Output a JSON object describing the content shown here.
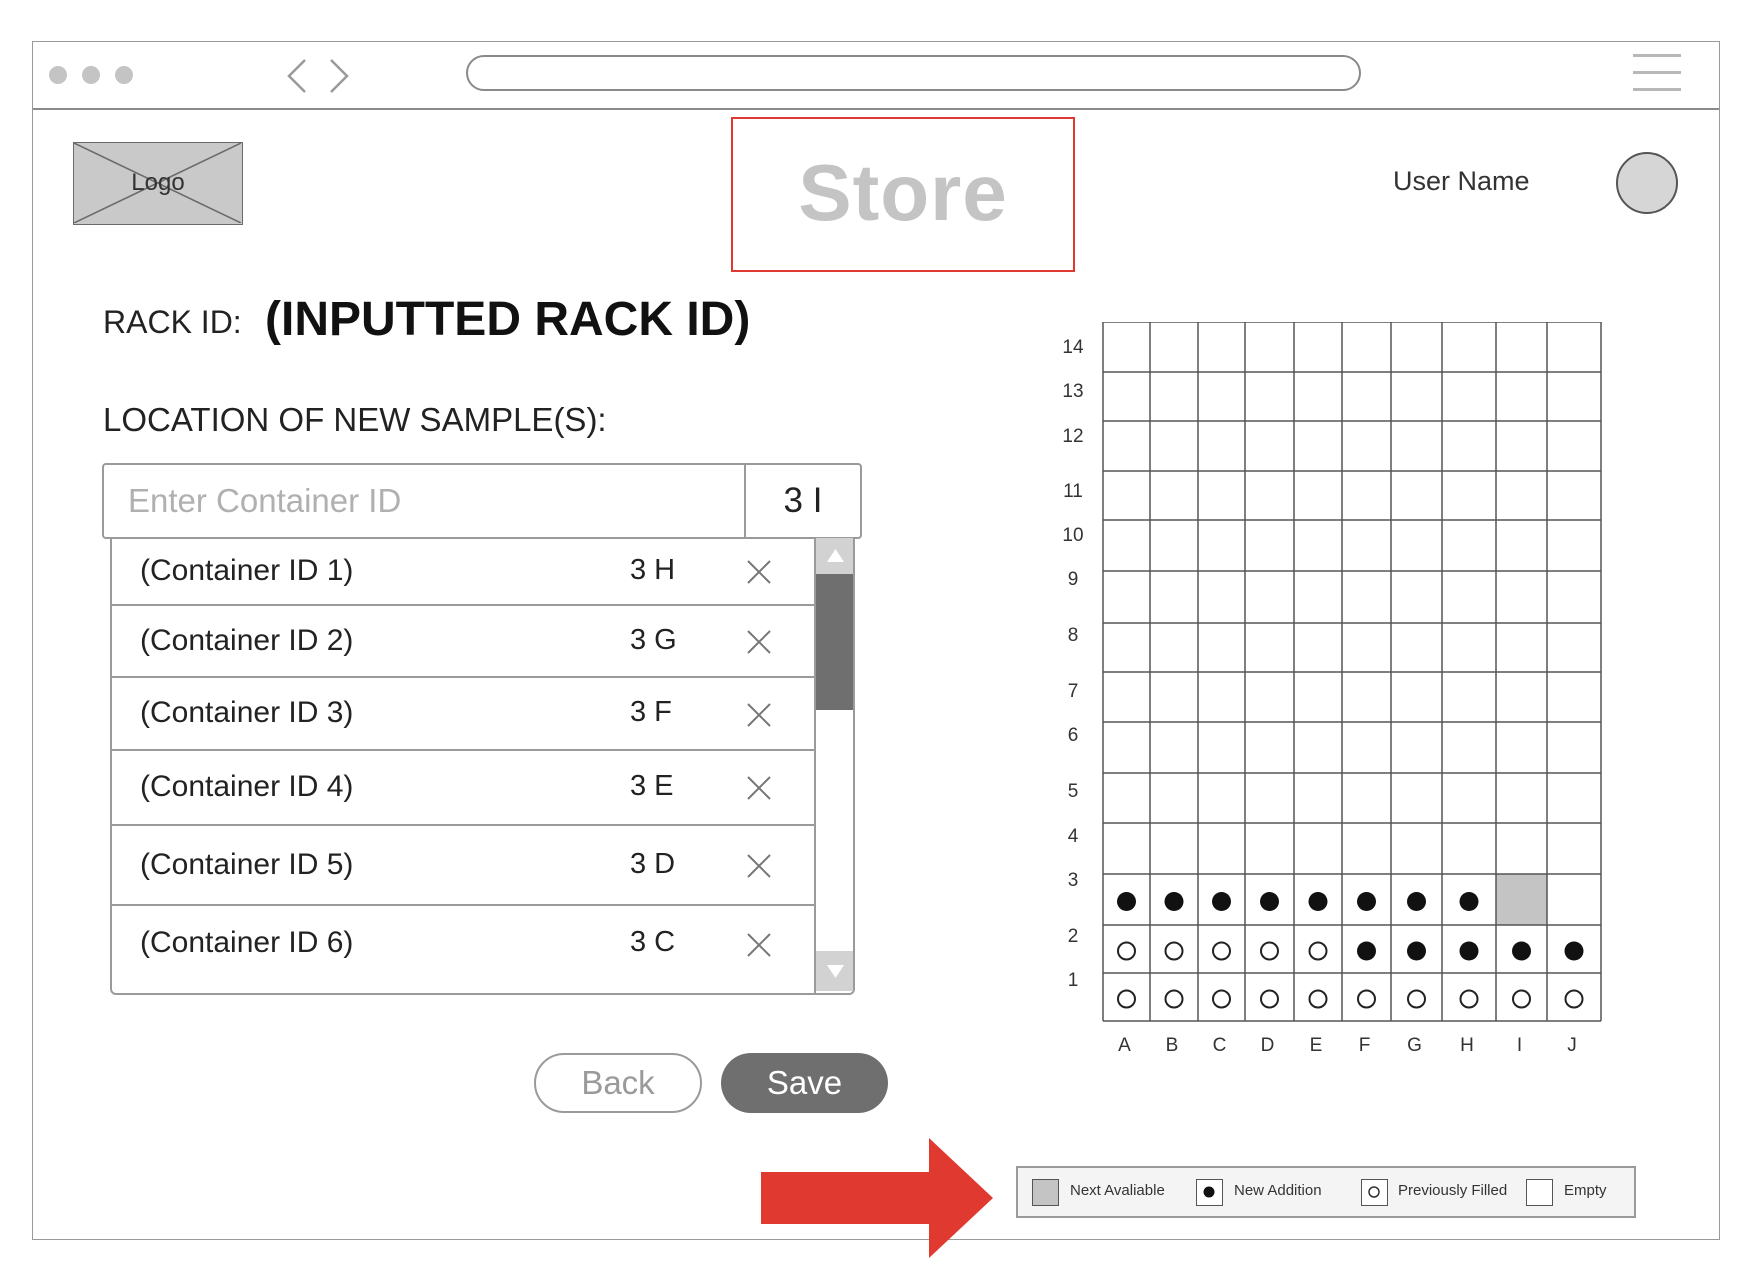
{
  "browser": {
    "window_dots": [
      "dot",
      "dot",
      "dot"
    ],
    "back_icon": "chevron-left-icon",
    "forward_icon": "chevron-right-icon",
    "menu_icon": "hamburger-icon"
  },
  "header": {
    "logo_label": "Logo",
    "title": "Store",
    "user_name": "User Name"
  },
  "rack": {
    "label": "RACK ID:",
    "value": "(INPUTTED RACK ID)"
  },
  "location": {
    "label": "LOCATION OF NEW SAMPLE(S):",
    "input_placeholder": "Enter Container ID",
    "input_value": "",
    "current_location": "3 I"
  },
  "containers": [
    {
      "id": "(Container ID 1)",
      "location": "3 H"
    },
    {
      "id": "(Container ID 2)",
      "location": "3 G"
    },
    {
      "id": "(Container ID 3)",
      "location": "3 F"
    },
    {
      "id": "(Container ID 4)",
      "location": "3 E"
    },
    {
      "id": "(Container ID 5)",
      "location": "3 D"
    },
    {
      "id": "(Container ID 6)",
      "location": "3 C"
    }
  ],
  "scrollbar": {
    "position": 0.0,
    "visible_fraction": 0.36
  },
  "actions": {
    "back_label": "Back",
    "save_label": "Save"
  },
  "rack_grid": {
    "columns": [
      "A",
      "B",
      "C",
      "D",
      "E",
      "F",
      "G",
      "H",
      "I",
      "J"
    ],
    "rows": [
      "14",
      "13",
      "12",
      "11",
      "10",
      "9",
      "8",
      "7",
      "6",
      "5",
      "4",
      "3",
      "2",
      "1"
    ],
    "cells": {
      "row_3": [
        "new",
        "new",
        "new",
        "new",
        "new",
        "new",
        "new",
        "new",
        "next",
        "empty"
      ],
      "row_2": [
        "prev",
        "prev",
        "prev",
        "prev",
        "prev",
        "new",
        "new",
        "new",
        "new",
        "new"
      ],
      "row_1": [
        "prev",
        "prev",
        "prev",
        "prev",
        "prev",
        "prev",
        "prev",
        "prev",
        "prev",
        "prev"
      ]
    }
  },
  "legend": {
    "next_available": "Next Avaliable",
    "new_addition": "New Addition",
    "previously_filled": "Previously Filled",
    "empty": "Empty"
  },
  "colors": {
    "highlight_border": "#e03a30",
    "arrow": "#e03a30",
    "next_available_fill": "#c4c4c4",
    "save_button": "#6f6f6f"
  }
}
